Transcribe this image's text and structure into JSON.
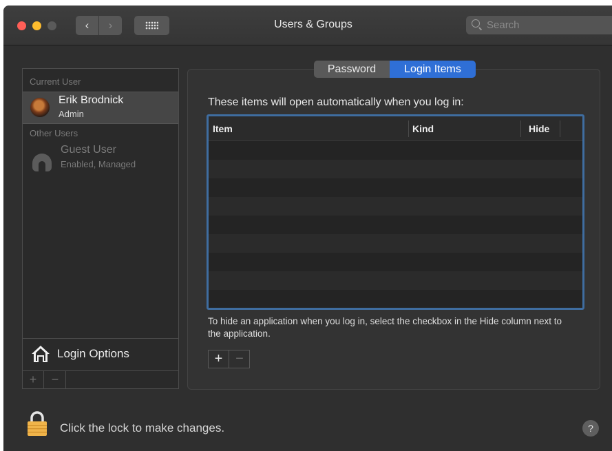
{
  "window": {
    "title": "Users & Groups",
    "nav_back": "‹",
    "nav_forward": "›",
    "search_placeholder": "Search"
  },
  "users": {
    "current_label": "Current User",
    "current": {
      "name": "Erik Brodnick",
      "role": "Admin"
    },
    "other_label": "Other Users",
    "others": [
      {
        "name": "Guest User",
        "status": "Enabled, Managed"
      }
    ],
    "login_options_label": "Login Options",
    "add_label": "+",
    "remove_label": "−"
  },
  "tabs": [
    {
      "label": "Password",
      "selected": false
    },
    {
      "label": "Login Items",
      "selected": true
    }
  ],
  "login_items": {
    "intro": "These items will open automatically when you log in:",
    "columns": [
      "Item",
      "Kind",
      "Hide"
    ],
    "rows": [],
    "help_text": "To hide an application when you log in, select the checkbox in the Hide column next to the application.",
    "add_label": "+",
    "remove_label": "−"
  },
  "footer": {
    "lock_text": "Click the lock to make changes.",
    "help_label": "?"
  },
  "colors": {
    "accent": "#2f6fd6",
    "table_focus_border": "#3f6da0",
    "close": "#ff5f57",
    "minimize": "#febc2e",
    "lock": "#f0b44a"
  },
  "icons": [
    "close-icon",
    "minimize-icon",
    "zoom-icon",
    "chevron-left-icon",
    "chevron-right-icon",
    "grid-icon",
    "search-icon",
    "user-avatar",
    "guest-icon",
    "house-icon",
    "lock-icon",
    "help-icon"
  ]
}
